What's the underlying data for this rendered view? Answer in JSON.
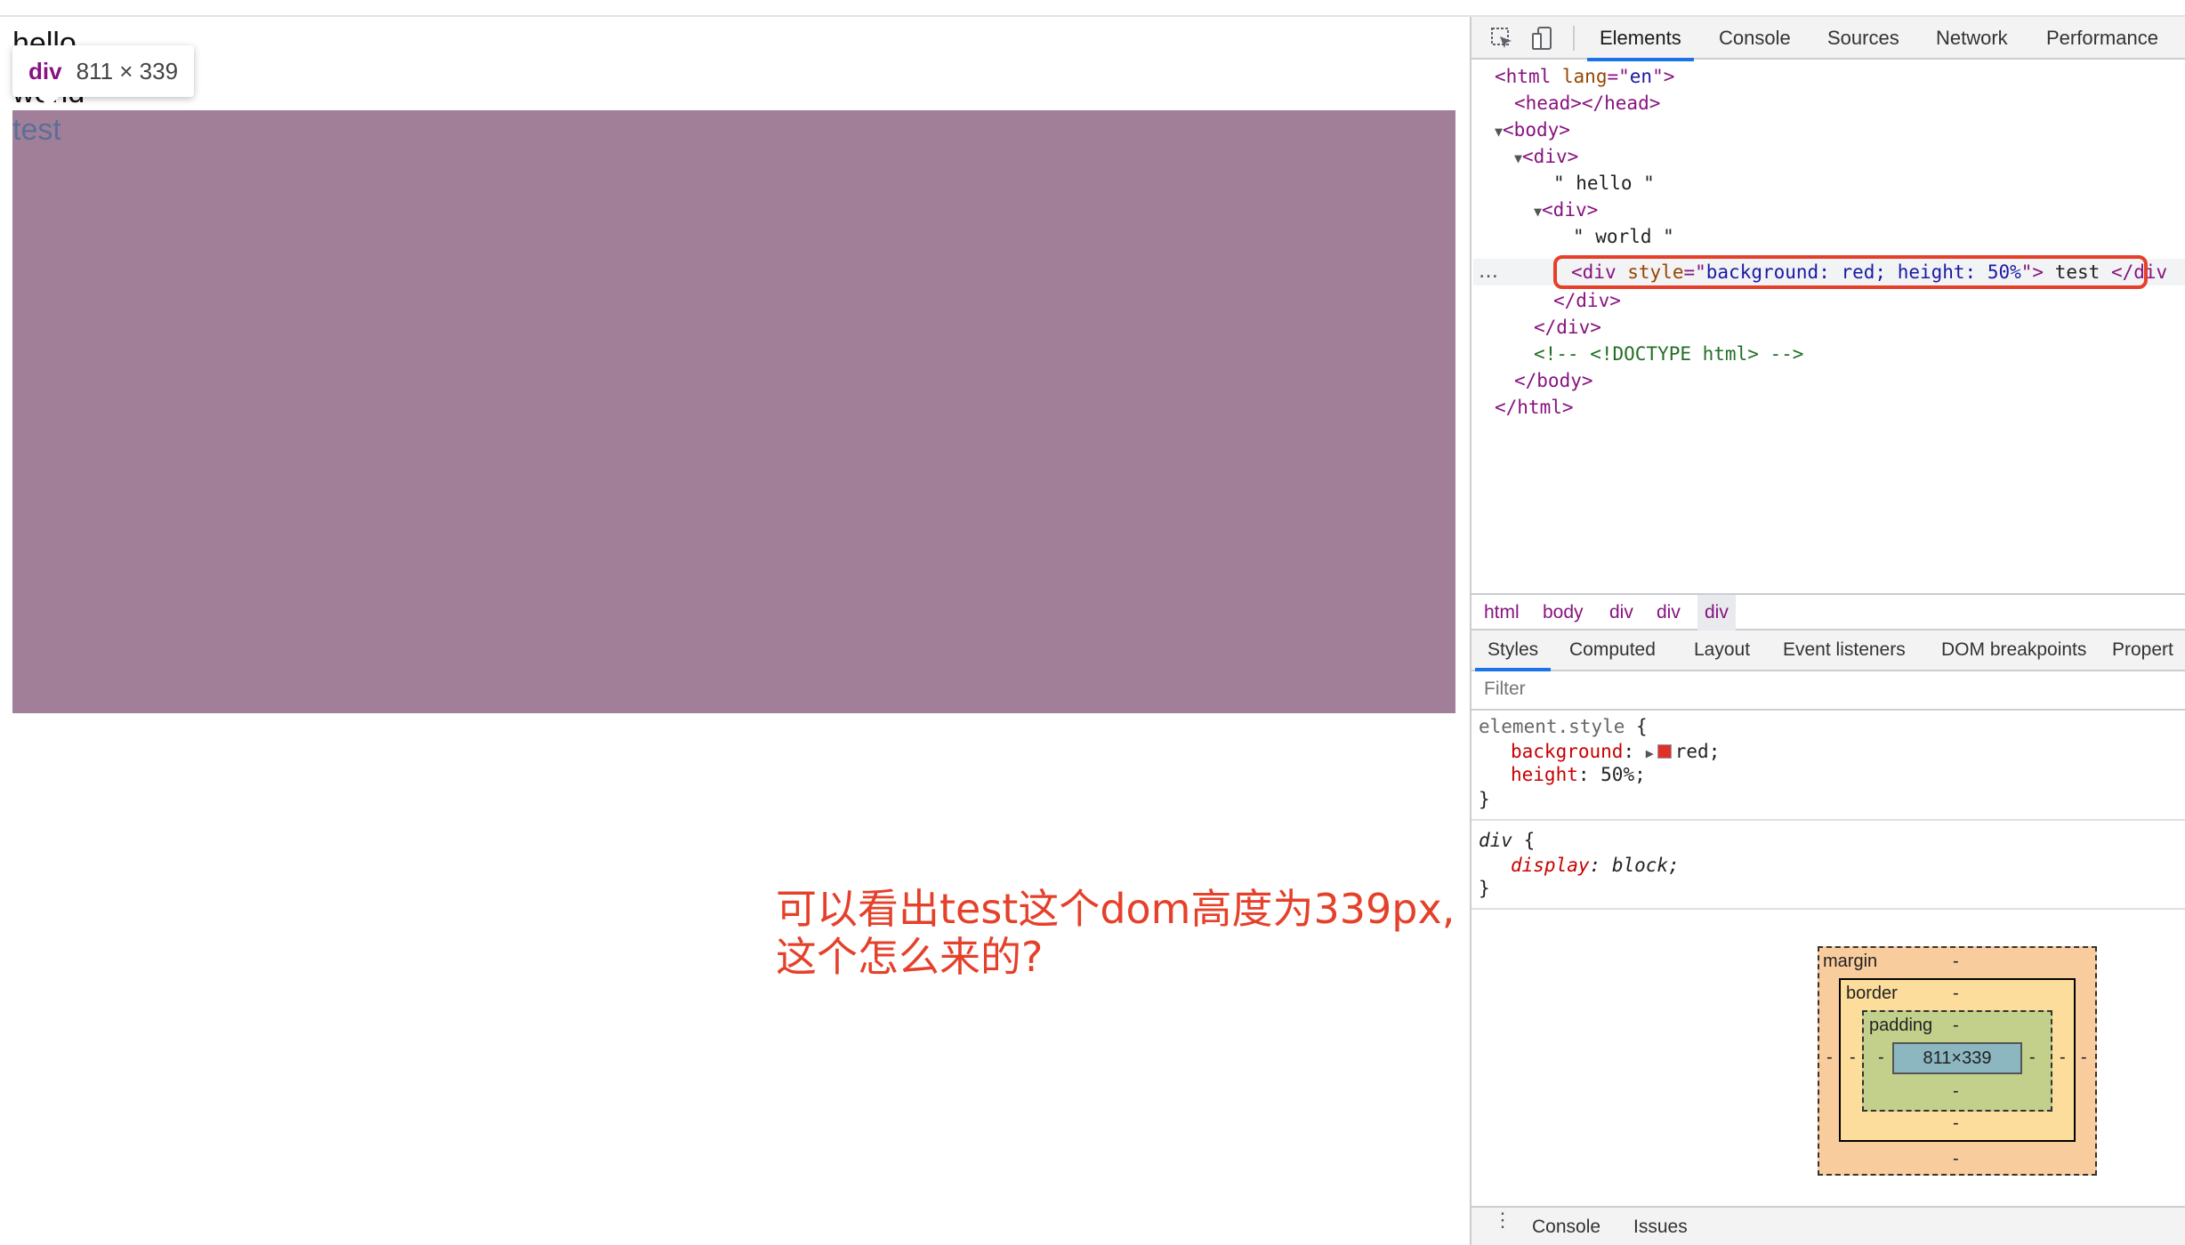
{
  "page": {
    "hello": "hello",
    "world": "world",
    "test": "test"
  },
  "tooltip": {
    "tag": "div",
    "size": "811 × 339"
  },
  "annotation": "可以看出test这个dom高度为339px,\n这个怎么来的?",
  "devtools": {
    "tabs": [
      "Elements",
      "Console",
      "Sources",
      "Network",
      "Performance"
    ],
    "active_tab": "Elements",
    "icons": [
      "inspect-element-icon",
      "device-toolbar-icon"
    ],
    "dom": {
      "html_open_tag": "html",
      "html_attr": "lang",
      "html_attr_val": "en",
      "head": "<head></head>",
      "body_open": "<body>",
      "div_open": "<div>",
      "hello_text": "\" hello \"",
      "inner_div_open": "<div>",
      "world_text": "\" world \"",
      "selected_tag": "div",
      "selected_attr": "style",
      "selected_attr_val": "background: red; height: 50%",
      "selected_text": "test",
      "selected_close": "</div",
      "inner_div_close": "</div>",
      "div_close": "</div>",
      "comment": "<!-- <!DOCTYPE html> -->",
      "body_close": "</body>",
      "html_close": "</html>",
      "ellipsis": "…"
    },
    "breadcrumb": [
      "html",
      "body",
      "div",
      "div",
      "div"
    ],
    "styles_tabs": [
      "Styles",
      "Computed",
      "Layout",
      "Event listeners",
      "DOM breakpoints",
      "Propert"
    ],
    "active_styles_tab": "Styles",
    "filter_placeholder": "Filter",
    "rules": {
      "element_style": {
        "selector": "element.style",
        "background_prop": "background",
        "background_val": "red",
        "height_prop": "height",
        "height_val": "50%"
      },
      "div_rule": {
        "selector": "div",
        "display_prop": "display",
        "display_val": "block"
      }
    },
    "box_model": {
      "margin_label": "margin",
      "border_label": "border",
      "padding_label": "padding",
      "content_size": "811×339",
      "dash": "-"
    },
    "drawer": [
      "Console",
      "Issues"
    ]
  },
  "colors": {
    "highlight": "#a27f99",
    "annotation": "#e5402a",
    "tag": "#881280",
    "accent": "#1a73e8"
  }
}
